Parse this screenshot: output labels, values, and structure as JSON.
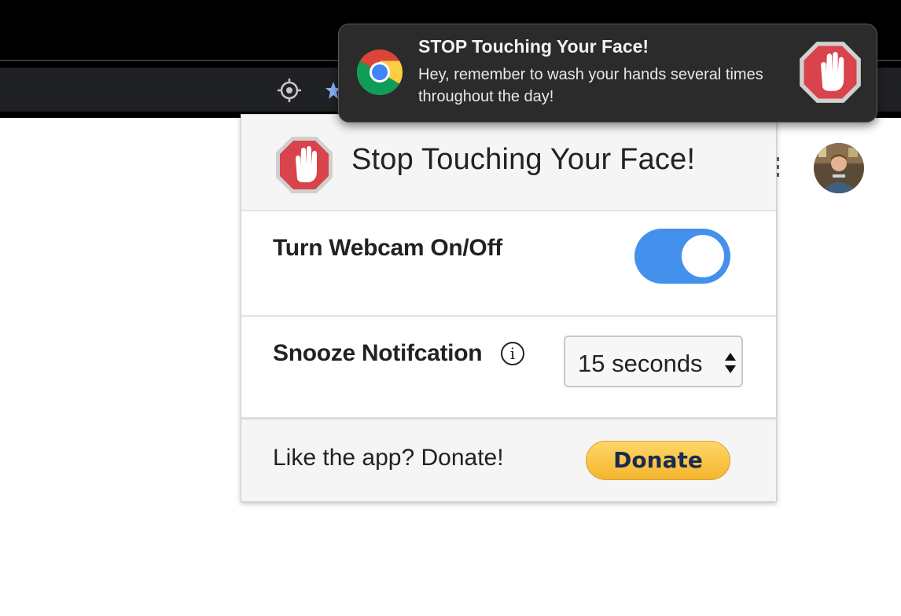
{
  "browser": {
    "toolbar_icons": [
      "location-crosshair-icon",
      "bookmark-star-icon"
    ],
    "menu_icon": "vertical-dots-icon",
    "avatar_icon": "profile-avatar"
  },
  "popup": {
    "title": "Stop Touching Your Face!",
    "logo_icon": "stop-hand-icon",
    "webcam": {
      "label": "Turn Webcam On/Off",
      "enabled": true,
      "toggle_color": "#4490ed"
    },
    "snooze": {
      "label": "Snooze Notifcation",
      "info_icon": "info-icon",
      "info_glyph": "i",
      "selected": "15 seconds"
    },
    "footer": {
      "text": "Like the app? Donate!",
      "donate_label": "Donate",
      "donate_color": "#f7c242"
    }
  },
  "notification": {
    "app_icon": "chrome-icon",
    "title": "STOP Touching Your Face!",
    "body": "Hey, remember to wash your hands several times throughout the day!",
    "image_icon": "stop-hand-icon",
    "stop_color": "#d9434c"
  }
}
